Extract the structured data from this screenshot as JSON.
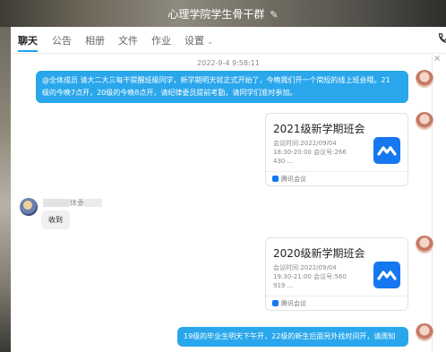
{
  "window": {
    "title": "心理学院学生骨干群",
    "edit_icon": "edit-icon"
  },
  "tabs": [
    {
      "label": "聊天",
      "active": true
    },
    {
      "label": "公告"
    },
    {
      "label": "相册"
    },
    {
      "label": "文件"
    },
    {
      "label": "作业"
    },
    {
      "label": "设置"
    }
  ],
  "settings_chevron": "⌄",
  "close_glyph": "×",
  "timestamp": "2022-9-4 9:58:11",
  "messages": {
    "announcement": {
      "line1": "@全体成员 请大二大三每干提醒班级同学，新学期明天就正式开始了，今晚我们开一个简短的线上班会哦。21",
      "line2": "级的今晚7点开，20级的今晚8点开，请纪律委员提前考勤，请同学们准时参加。"
    },
    "card1": {
      "title": "2021级新学期班会",
      "line1": "会议时间:2022/09/04",
      "line2": "18:30-20:00 会议号:266",
      "line3": "430 ...",
      "footer": "腾讯会议"
    },
    "reply": {
      "sender_suffix": "体委",
      "text": "收到"
    },
    "card2": {
      "title": "2020级新学期班会",
      "line1": "会议时间:2022/09/04",
      "line2": "19:30-21:00 会议号:560",
      "line3": "919 ...",
      "footer": "腾讯会议"
    },
    "last": {
      "text": "19级的毕业生明天下午开，22级的新生后面另外找时间开，请周知"
    }
  },
  "colors": {
    "accent": "#1aa6ef",
    "bubble": "#2aa7ec",
    "meeting_brand": "#1678f0"
  }
}
